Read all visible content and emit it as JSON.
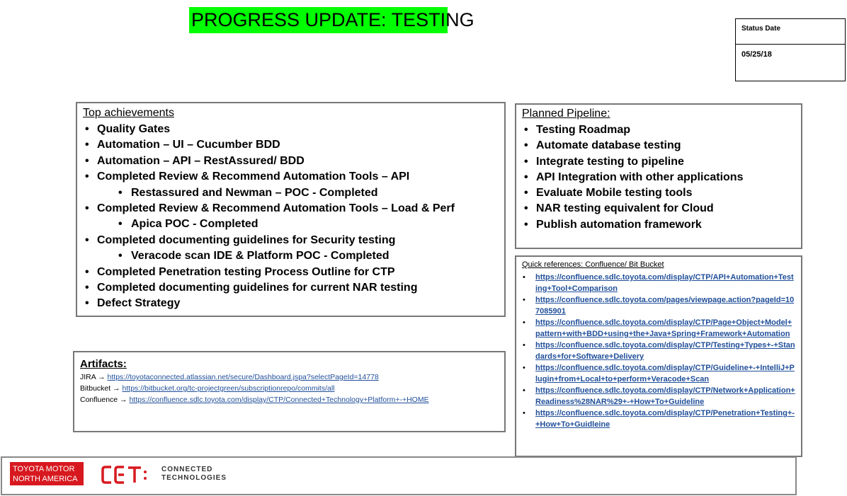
{
  "title": "PROGRESS UPDATE: TESTING",
  "status": {
    "label": "Status Date",
    "value": "05/25/18"
  },
  "achievements": {
    "heading": "Top achievements",
    "items": [
      "Quality Gates",
      "Automation – UI – Cucumber BDD",
      "Automation – API – RestAssured/ BDD",
      "Completed Review & Recommend Automation Tools – API",
      "Restassured and Newman – POC - Completed",
      "Completed Review & Recommend Automation Tools – Load & Perf",
      "Apica POC - Completed",
      "Completed documenting guidelines for Security testing",
      "Veracode scan IDE & Platform POC -  Completed",
      "Completed Penetration testing Process Outline for CTP",
      "Completed documenting guidelines for current NAR testing",
      "Defect Strategy"
    ]
  },
  "pipeline": {
    "heading": "Planned Pipeline:",
    "items": [
      "Testing Roadmap",
      "Automate database testing",
      "Integrate testing to pipeline",
      "API Integration with other applications",
      "Evaluate Mobile testing tools",
      "NAR testing equivalent for Cloud",
      "Publish automation framework"
    ]
  },
  "artifacts": {
    "heading": "Artifacts:",
    "arrow": "→",
    "links": [
      {
        "label": "JIRA",
        "url": "https://toyotaconnected.atlassian.net/secure/Dashboard.jspa?selectPageId=14778"
      },
      {
        "label": "Bitbucket",
        "url": "https://bitbucket.org/tc-projectgreen/subscriptionrepo/commits/all"
      },
      {
        "label": "Confluence",
        "url": "https://confluence.sdlc.toyota.com/display/CTP/Connected+Technology+Platform+-+HOME"
      }
    ]
  },
  "quickrefs": {
    "heading": "Quick references: Confluence/ Bit Bucket",
    "links": [
      "https://confluence.sdlc.toyota.com/display/CTP/API+Automation+Testing+Tool+Comparison",
      "https://confluence.sdlc.toyota.com/pages/viewpage.action?pageId=107085901",
      "https://confluence.sdlc.toyota.com/display/CTP/Page+Object+Model+pattern+with+BDD+using+the+Java+Spring+Framework+Automation",
      "https://confluence.sdlc.toyota.com/display/CTP/Testing+Types+-+Standards+for+Software+Delivery",
      "https://confluence.sdlc.toyota.com/display/CTP/Guideline+-+IntelliJ+Plugin+from+Local+to+perform+Veracode+Scan",
      "https://confluence.sdlc.toyota.com/display/CTP/Network+Application+Readiness%28NAR%29+-+How+To+Guideline",
      "https://confluence.sdlc.toyota.com/display/CTP/Penetration+Testing+-+How+To+Guidleine"
    ]
  },
  "footer": {
    "tm_line1": "TOYOTA MOTOR",
    "tm_line2": "NORTH AMERICA",
    "ct_mark": "CCT",
    "ct_line1": "CONNECTED",
    "ct_line2": "TECHNOLOGIES",
    "colors": {
      "toyota_red": "#d7191f",
      "link_blue": "#1f4e99",
      "title_green": "#00ff00"
    }
  }
}
